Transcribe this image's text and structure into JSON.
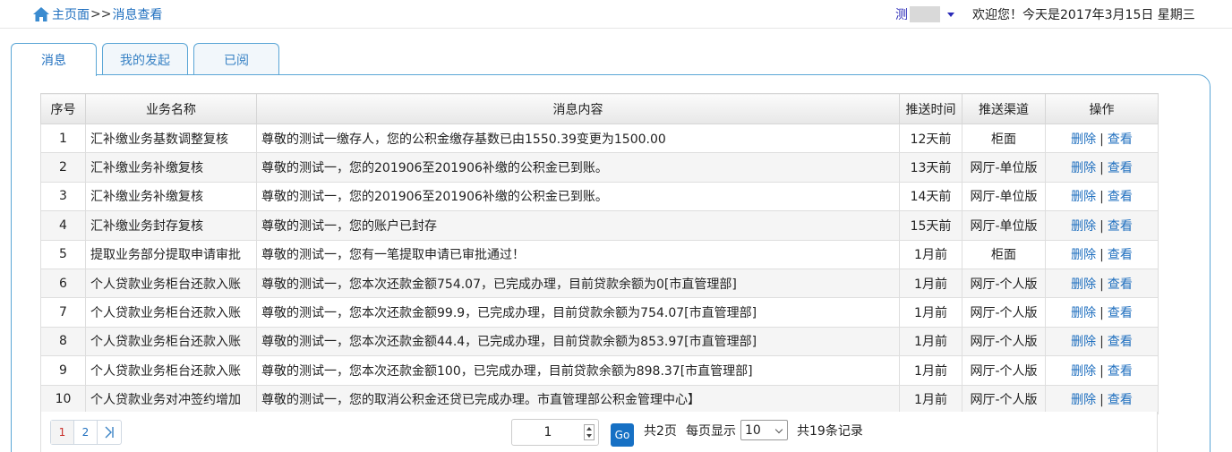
{
  "header": {
    "home_label": "主页面",
    "separator": ">>",
    "current": "消息查看",
    "user_name": "测",
    "welcome": "欢迎您！今天是2017年3月15日 星期三"
  },
  "tabs": [
    {
      "label": "消息",
      "active": true
    },
    {
      "label": "我的发起",
      "active": false
    },
    {
      "label": "已阅",
      "active": false
    }
  ],
  "table": {
    "columns": [
      "序号",
      "业务名称",
      "消息内容",
      "推送时间",
      "推送渠道",
      "操作"
    ],
    "delete_label": "删除",
    "view_label": "查看",
    "action_sep": "|",
    "rows": [
      {
        "no": "1",
        "business": "汇补缴业务基数调整复核",
        "content": "尊敬的测试一缴存人，您的公积金缴存基数已由1550.39变更为1500.00",
        "time": "12天前",
        "channel": "柜面"
      },
      {
        "no": "2",
        "business": "汇补缴业务补缴复核",
        "content": "尊敬的测试一，您的201906至201906补缴的公积金已到账。",
        "time": "13天前",
        "channel": "网厅-单位版"
      },
      {
        "no": "3",
        "business": "汇补缴业务补缴复核",
        "content": "尊敬的测试一，您的201906至201906补缴的公积金已到账。",
        "time": "14天前",
        "channel": "网厅-单位版"
      },
      {
        "no": "4",
        "business": "汇补缴业务封存复核",
        "content": "尊敬的测试一，您的账户已封存",
        "time": "15天前",
        "channel": "网厅-单位版"
      },
      {
        "no": "5",
        "business": "提取业务部分提取申请审批",
        "content": "尊敬的测试一，您有一笔提取申请已审批通过！",
        "time": "1月前",
        "channel": "柜面"
      },
      {
        "no": "6",
        "business": "个人贷款业务柜台还款入账",
        "content": "尊敬的测试一，您本次还款金额754.07，已完成办理，目前贷款余额为0[市直管理部]",
        "time": "1月前",
        "channel": "网厅-个人版"
      },
      {
        "no": "7",
        "business": "个人贷款业务柜台还款入账",
        "content": "尊敬的测试一，您本次还款金额99.9，已完成办理，目前贷款余额为754.07[市直管理部]",
        "time": "1月前",
        "channel": "网厅-个人版"
      },
      {
        "no": "8",
        "business": "个人贷款业务柜台还款入账",
        "content": "尊敬的测试一，您本次还款金额44.4，已完成办理，目前贷款余额为853.97[市直管理部]",
        "time": "1月前",
        "channel": "网厅-个人版"
      },
      {
        "no": "9",
        "business": "个人贷款业务柜台还款入账",
        "content": "尊敬的测试一，您本次还款金额100，已完成办理，目前贷款余额为898.37[市直管理部]",
        "time": "1月前",
        "channel": "网厅-个人版"
      },
      {
        "no": "10",
        "business": "个人贷款业务对冲签约增加",
        "content": "尊敬的测试一，您的取消公积金还贷已完成办理。市直管理部公积金管理中心】",
        "time": "1月前",
        "channel": "网厅-个人版"
      }
    ]
  },
  "pager": {
    "pages": [
      "1",
      "2"
    ],
    "current_page": "1",
    "input_value": "1",
    "go_label": "Go",
    "total_pages_text": "共2页",
    "page_size_label": "每页显示",
    "page_size": "10",
    "total_records_text": "共19条记录"
  },
  "colors": {
    "link": "#1f6fbf",
    "tab_border": "#5ba6d6",
    "go_button": "#1670c4",
    "current_page": "#c9302c"
  }
}
